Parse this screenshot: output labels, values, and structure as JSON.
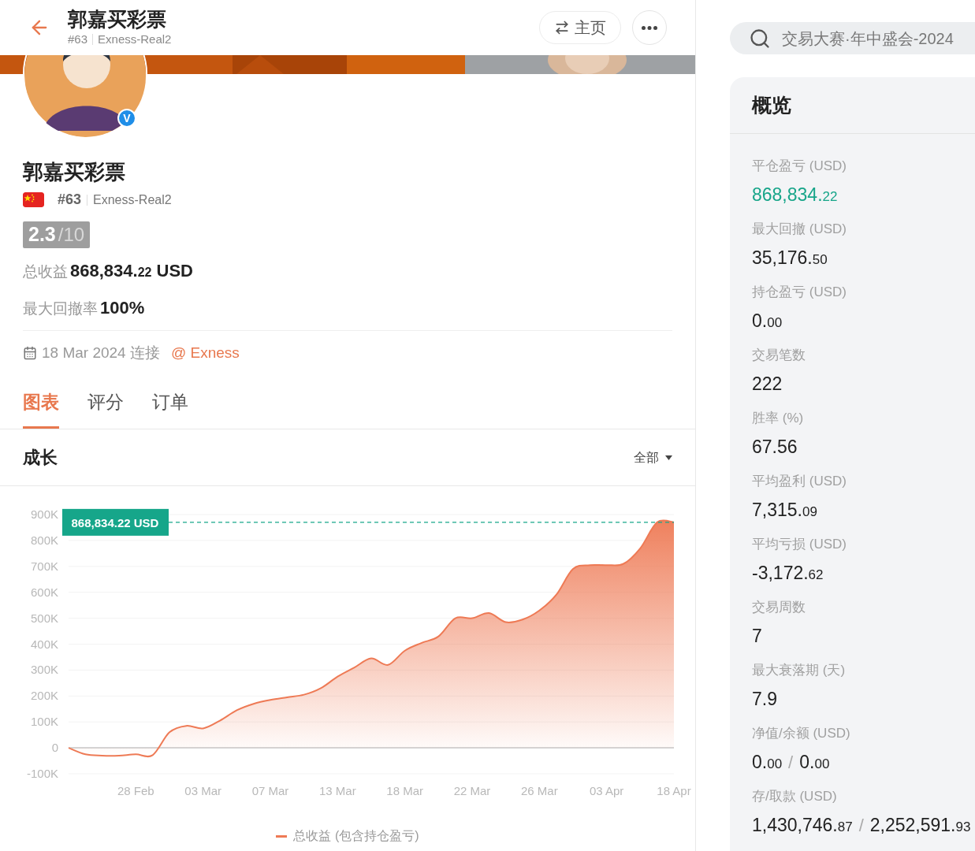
{
  "header": {
    "title": "郭嘉买彩票",
    "rank": "#63",
    "account": "Exness-Real2",
    "home_button": "主页"
  },
  "profile": {
    "badge": "V",
    "name": "郭嘉买彩票",
    "rank": "#63",
    "account": "Exness-Real2",
    "score": "2.3",
    "score_max": "/10",
    "total_label": "总收益",
    "total": {
      "whole": "868,834.",
      "fraction": "22",
      "unit": "USD"
    },
    "drawdown_label": "最大回撤率",
    "drawdown": "100%",
    "date": "18 Mar 2024 连接",
    "broker": "@ Exness"
  },
  "tabs": [
    {
      "label": "图表",
      "selected": true
    },
    {
      "label": "评分",
      "selected": false
    },
    {
      "label": "订单",
      "selected": false
    }
  ],
  "growth": {
    "title": "成长",
    "range": "全部",
    "chart_data": {
      "type": "area",
      "categories": [
        null,
        null,
        null,
        null,
        "28 Feb",
        null,
        null,
        null,
        "03 Mar",
        null,
        null,
        null,
        "07 Mar",
        null,
        null,
        null,
        "13 Mar",
        null,
        null,
        null,
        "18 Mar",
        null,
        null,
        null,
        "22 Mar",
        null,
        null,
        null,
        "26 Mar",
        null,
        null,
        null,
        "03 Apr",
        null,
        null,
        null,
        "18 Apr"
      ],
      "series": [
        {
          "name": "总收益 (包含持仓盈亏)",
          "color": "#ee7a55",
          "values": [
            0,
            -25000,
            -30000,
            -30000,
            -25000,
            -28000,
            60000,
            85000,
            75000,
            105000,
            145000,
            170000,
            185000,
            195000,
            205000,
            230000,
            275000,
            310000,
            345000,
            320000,
            375000,
            405000,
            430000,
            500000,
            500000,
            520000,
            485000,
            495000,
            530000,
            590000,
            690000,
            705000,
            705000,
            710000,
            770000,
            870000,
            870000
          ]
        }
      ],
      "ylim": [
        -100000,
        900000
      ],
      "yticks": [
        {
          "value": 900000,
          "label": "900K"
        },
        {
          "value": 800000,
          "label": "800K"
        },
        {
          "value": 700000,
          "label": "700K"
        },
        {
          "value": 600000,
          "label": "600K"
        },
        {
          "value": 500000,
          "label": "500K"
        },
        {
          "value": 400000,
          "label": "400K"
        },
        {
          "value": 300000,
          "label": "300K"
        },
        {
          "value": 200000,
          "label": "200K"
        },
        {
          "value": 100000,
          "label": "100K"
        },
        {
          "value": 0,
          "label": "0"
        },
        {
          "value": -100000,
          "label": "-100K"
        }
      ],
      "grid": true,
      "ref_lines": [
        {
          "axis": "y",
          "value": 870000,
          "label": "868,834.22 USD",
          "color": "#16a68a"
        }
      ]
    }
  },
  "search": {
    "value": "交易大赛·年中盛会-2024"
  },
  "overview": {
    "title": "概览",
    "stats": [
      {
        "label": "平仓盈亏 (USD)",
        "positive": true,
        "values": [
          {
            "whole": "868,834.",
            "fraction": "22"
          }
        ]
      },
      {
        "label": "最大回撤 (USD)",
        "positive": false,
        "values": [
          {
            "whole": "35,176.",
            "fraction": "50"
          }
        ]
      },
      {
        "label": "持仓盈亏 (USD)",
        "positive": false,
        "values": [
          {
            "whole": "0.",
            "fraction": "00"
          }
        ]
      },
      {
        "label": "交易笔数",
        "positive": false,
        "values": [
          {
            "whole": "222"
          }
        ]
      },
      {
        "label": "胜率 (%)",
        "positive": false,
        "values": [
          {
            "whole": "67.56"
          }
        ]
      },
      {
        "label": "平均盈利 (USD)",
        "positive": false,
        "values": [
          {
            "whole": "7,315.",
            "fraction": "09"
          }
        ]
      },
      {
        "label": "平均亏损 (USD)",
        "positive": false,
        "values": [
          {
            "whole": "-3,172.",
            "fraction": "62"
          }
        ]
      },
      {
        "label": "交易周数",
        "positive": false,
        "values": [
          {
            "whole": "7"
          }
        ]
      },
      {
        "label": "最大衰落期 (天)",
        "positive": false,
        "values": [
          {
            "whole": "7.9"
          }
        ]
      },
      {
        "label": "净值/余额 (USD)",
        "positive": false,
        "separator": "/",
        "values": [
          {
            "whole": "0.",
            "fraction": "00"
          },
          {
            "whole": "0.",
            "fraction": "00"
          }
        ]
      },
      {
        "label": "存/取款 (USD)",
        "positive": false,
        "separator": "/",
        "values": [
          {
            "whole": "1,430,746.",
            "fraction": "87"
          },
          {
            "whole": "2,252,591.",
            "fraction": "93"
          }
        ]
      }
    ]
  }
}
